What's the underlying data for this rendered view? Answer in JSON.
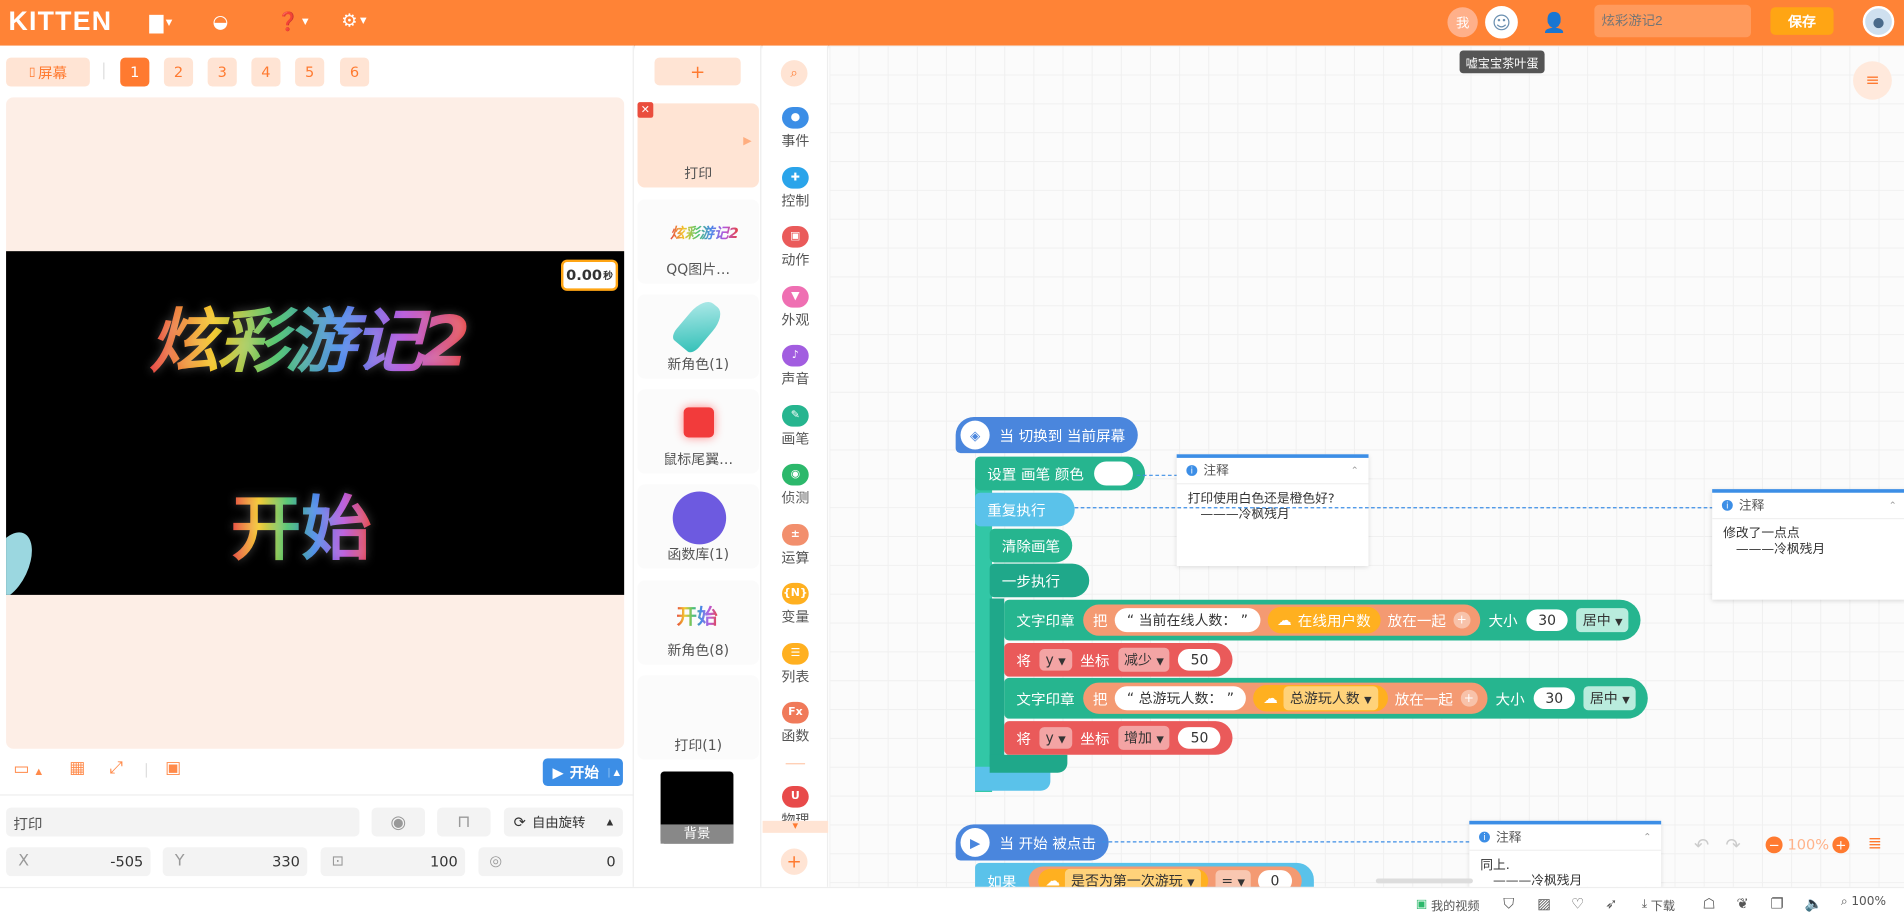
{
  "app": {
    "logo": "KITTEN"
  },
  "topbar": {
    "user_badge": "我",
    "project_name_placeholder": "炫彩游记2",
    "save_label": "保存",
    "tooltip": "嘘宝宝茶叶蛋"
  },
  "stage": {
    "screen_label": "屏幕",
    "screens": [
      "1",
      "2",
      "3",
      "4",
      "5",
      "6"
    ],
    "canvas_title": "炫彩游记2",
    "canvas_start": "开始",
    "timer": "0.00",
    "timer_unit": "秒",
    "play_label": "开始",
    "props": {
      "name": "打印",
      "rotation_mode": "自由旋转",
      "x_label": "X",
      "x": "-505",
      "y_label": "Y",
      "y": "330",
      "size": "100",
      "direction": "0"
    }
  },
  "sprites": {
    "add_label": "+",
    "items": [
      {
        "name": "打印",
        "selected": true
      },
      {
        "name": "QQ图片…",
        "thumb_text": "炫彩游记2"
      },
      {
        "name": "新角色(1)"
      },
      {
        "name": "鼠标尾翼…"
      },
      {
        "name": "函数库(1)"
      },
      {
        "name": "新角色(8)",
        "thumb_text": "开始"
      },
      {
        "name": "打印(1)"
      },
      {
        "name": "背景"
      }
    ]
  },
  "categories": [
    {
      "name": "事件",
      "color": "#3c8ee6"
    },
    {
      "name": "控制",
      "color": "#2aa4ea"
    },
    {
      "name": "动作",
      "color": "#ea5a5a"
    },
    {
      "name": "外观",
      "color": "#ef6fb2"
    },
    {
      "name": "声音",
      "color": "#a25de0"
    },
    {
      "name": "画笔",
      "color": "#26b58f"
    },
    {
      "name": "侦测",
      "color": "#2cb86b"
    },
    {
      "name": "运算",
      "color": "#f28f6d"
    },
    {
      "name": "变量",
      "color": "#ffb020"
    },
    {
      "name": "列表",
      "color": "#ffb020"
    },
    {
      "name": "函数",
      "color": "#f07a5a"
    },
    {
      "name": "物理",
      "color": "#e84a4a"
    }
  ],
  "blocks": {
    "hat1": "当 切换到 当前屏幕",
    "set_pen_color": "设置 画笔 颜色",
    "repeat": "重复执行",
    "clear_pen": "清除画笔",
    "step_exec": "一步执行",
    "text_stamp": "文字印章",
    "ba": "把",
    "str_online": "“ 当前在线人数： ”",
    "online_users": "在线用户数",
    "join": "放在一起",
    "size": "大小",
    "size_val": "30",
    "align": "居中",
    "jiang": "将",
    "y": "y",
    "coord": "坐标",
    "decrease": "减少",
    "increase": "增加",
    "step_val": "50",
    "str_total": "“ 总游玩人数： ”",
    "total_players": "总游玩人数",
    "hat2": "当 开始 被点击",
    "if": "如果",
    "first_play": "是否为第一次游玩",
    "eq": "=",
    "zero": "0"
  },
  "notes": [
    {
      "title": "注释",
      "body": "打印使用白色还是橙色好?\n　———冷枫残月"
    },
    {
      "title": "注释",
      "body": "修改了一点点\n　———冷枫残月"
    },
    {
      "title": "注释",
      "body": "同上.\n　———冷枫残月"
    }
  ],
  "zoom": "100%",
  "bottom": {
    "my_video": "我的视频",
    "download": "下载",
    "zoom": "100%"
  }
}
